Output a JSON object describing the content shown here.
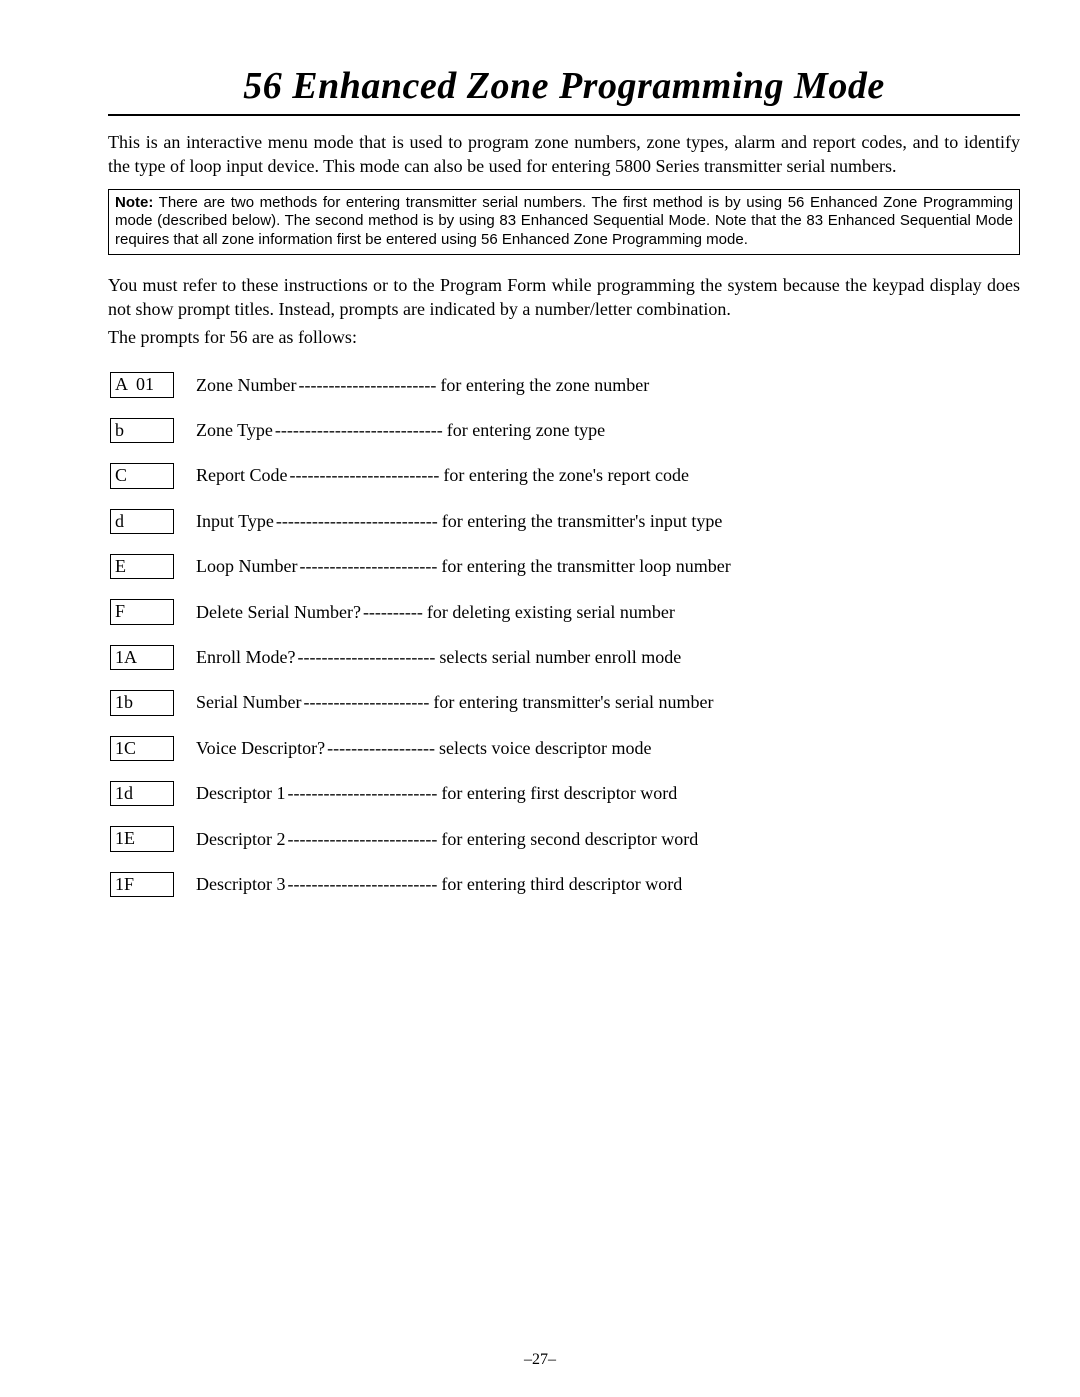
{
  "title": "56 Enhanced Zone Programming Mode",
  "intro": "This is an interactive menu mode that is used to program zone numbers, zone types, alarm and report codes, and to identify the type of loop input device. This mode can also be used for entering 5800 Series transmitter serial numbers.",
  "note_label": "Note:",
  "note_text": " There are two methods for entering transmitter serial numbers. The first method is by using   56 Enhanced Zone Programming mode (described below). The second method is by using   83 Enhanced Sequential Mode. Note that the   83 Enhanced Sequential Mode requires that all zone information first be entered using   56 Enhanced Zone Programming mode.",
  "instructions": "You must refer to these instructions or to the Program Form while programming the system because the keypad display does not show prompt titles.  Instead, prompts are indicated by a number/letter combination.",
  "prompts_lead": "The prompts for   56 are as follows:",
  "prompts": [
    {
      "code": "A  01",
      "label": "Zone Number",
      "dashes": "-----------------------",
      "desc": "for entering the zone number"
    },
    {
      "code": "b",
      "label": "Zone Type",
      "dashes": "----------------------------",
      "desc": "for entering zone type"
    },
    {
      "code": "C",
      "label": "Report Code",
      "dashes": "-------------------------",
      "desc": "for entering the zone's report code"
    },
    {
      "code": "d",
      "label": "Input Type",
      "dashes": "---------------------------",
      "desc": "for entering the transmitter's input type"
    },
    {
      "code": "E",
      "label": "Loop Number",
      "dashes": "-----------------------",
      "desc": "for entering the transmitter loop number"
    },
    {
      "code": "F",
      "label": "Delete Serial Number?",
      "dashes": "----------",
      "desc": "for deleting existing serial number"
    },
    {
      "code": "1A",
      "label": "Enroll Mode?",
      "dashes": "-----------------------",
      "desc": "selects serial number enroll mode"
    },
    {
      "code": "1b",
      "label": "Serial Number",
      "dashes": "---------------------",
      "desc": "for entering transmitter's serial number"
    },
    {
      "code": "1C",
      "label": "Voice Descriptor?",
      "dashes": "------------------",
      "desc": "selects voice descriptor mode"
    },
    {
      "code": "1d",
      "label": "Descriptor 1",
      "dashes": "-------------------------",
      "desc": "for entering first descriptor word"
    },
    {
      "code": "1E",
      "label": "Descriptor 2",
      "dashes": "-------------------------",
      "desc": "for entering second descriptor word"
    },
    {
      "code": "1F",
      "label": "Descriptor 3",
      "dashes": "-------------------------",
      "desc": "for entering third descriptor word"
    }
  ],
  "page_number": "–27–"
}
